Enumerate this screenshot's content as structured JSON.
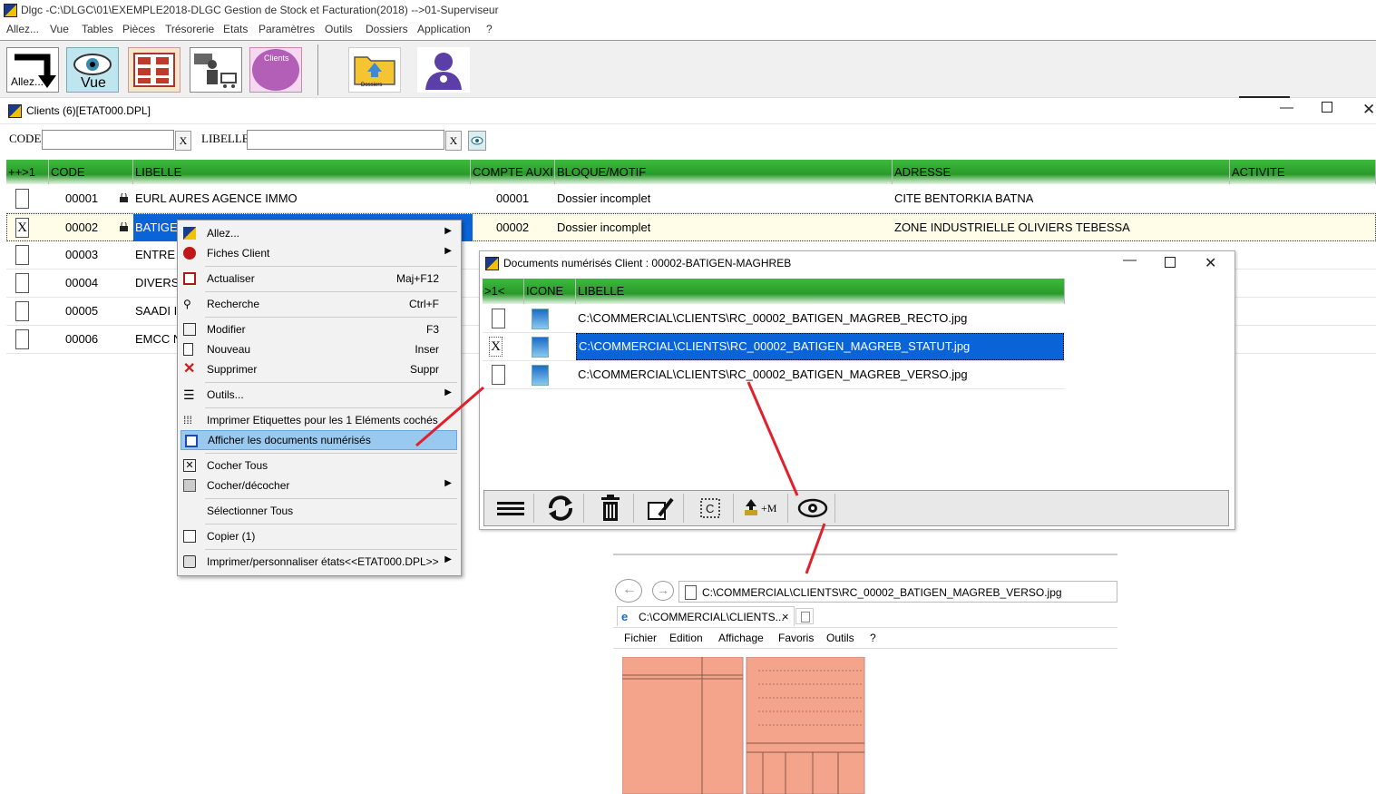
{
  "app": {
    "title": "Dlgc -C:\\DLGC\\01\\EXEMPLE2018-DLGC Gestion de Stock et Facturation(2018) -->01-Superviseur",
    "menu": [
      "Allez...",
      "Vue",
      "Tables",
      "Pièces",
      "Trésorerie",
      "Etats",
      "Paramètres",
      "Outils",
      "Dossiers",
      "Application",
      "?"
    ]
  },
  "toolbar": {
    "allez_label": "Allez...",
    "vue_label": "Vue",
    "clients_label": "Clients",
    "dossiers_label": "Dossiers"
  },
  "clients_window": {
    "title": "Clients (6)[ETAT000.DPL]",
    "filter": {
      "code_label": "CODE:",
      "libelle_label": "LIBELLE:",
      "clear": "X"
    },
    "columns": [
      "++>1",
      "CODE",
      "LIBELLE",
      "COMPTE AUXI",
      "BLOQUE/MOTIF",
      "ADRESSE",
      "ACTIVITE"
    ],
    "rows": [
      {
        "checked": "",
        "code": "00001",
        "libelle": "EURL AURES AGENCE IMMO",
        "compte": "00001",
        "motif": "Dossier incomplet",
        "adresse": "CITE BENTORKIA BATNA"
      },
      {
        "checked": "X",
        "code": "00002",
        "libelle": "BATIGE",
        "compte": "00002",
        "motif": "Dossier incomplet",
        "adresse": "ZONE INDUSTRIELLE OLIVIERS TEBESSA"
      },
      {
        "checked": "",
        "code": "00003",
        "libelle": "ENTRE"
      },
      {
        "checked": "",
        "code": "00004",
        "libelle": "DIVERS"
      },
      {
        "checked": "",
        "code": "00005",
        "libelle": "SAADI I"
      },
      {
        "checked": "",
        "code": "00006",
        "libelle": "EMCC N"
      }
    ]
  },
  "context_menu": {
    "items": [
      {
        "label": "Allez...",
        "shortcut": "",
        "submenu": true
      },
      {
        "label": "Fiches Client",
        "shortcut": "",
        "submenu": true
      },
      {
        "label": "Actualiser",
        "shortcut": "Maj+F12"
      },
      {
        "label": "Recherche",
        "shortcut": "Ctrl+F"
      },
      {
        "label": "Modifier",
        "shortcut": "F3"
      },
      {
        "label": "Nouveau",
        "shortcut": "Inser"
      },
      {
        "label": "Supprimer",
        "shortcut": "Suppr"
      },
      {
        "label": "Outils...",
        "shortcut": "",
        "submenu": true
      },
      {
        "label": "Imprimer Etiquettes pour les 1 Eléments cochés",
        "shortcut": ""
      },
      {
        "label": "Afficher les documents numérisés",
        "shortcut": "",
        "highlighted": true
      },
      {
        "label": "Cocher Tous",
        "shortcut": ""
      },
      {
        "label": "Cocher/décocher",
        "shortcut": "",
        "submenu": true
      },
      {
        "label": "Sélectionner Tous",
        "shortcut": ""
      },
      {
        "label": "Copier (1)",
        "shortcut": ""
      },
      {
        "label": "Imprimer/personnaliser états<<ETAT000.DPL>>",
        "shortcut": "",
        "submenu": true
      }
    ]
  },
  "docs_window": {
    "title": "Documents numérisés Client : 00002-BATIGEN-MAGHREB",
    "columns": [
      ">1<",
      "ICONE",
      "LIBELLE"
    ],
    "rows": [
      {
        "checked": "",
        "libelle": "C:\\COMMERCIAL\\CLIENTS\\RC_00002_BATIGEN_MAGREB_RECTO.jpg"
      },
      {
        "checked": "X",
        "libelle": "C:\\COMMERCIAL\\CLIENTS\\RC_00002_BATIGEN_MAGREB_STATUT.jpg"
      },
      {
        "checked": "",
        "libelle": "C:\\COMMERCIAL\\CLIENTS\\RC_00002_BATIGEN_MAGREB_VERSO.jpg"
      }
    ],
    "refresh_label": "+M"
  },
  "browser": {
    "address": "C:\\COMMERCIAL\\CLIENTS\\RC_00002_BATIGEN_MAGREB_VERSO.jpg",
    "tab_title": "C:\\COMMERCIAL\\CLIENTS...",
    "tab_close": "×",
    "menu": [
      "Fichier",
      "Edition",
      "Affichage",
      "Favoris",
      "Outils",
      "?"
    ]
  },
  "colors": {
    "header_green": "#2a9a2a",
    "selection_blue": "#0a64d8",
    "menu_highlight": "#99c9ef",
    "annotation_red": "#e0202a",
    "document_salmon": "#f3a48a"
  }
}
